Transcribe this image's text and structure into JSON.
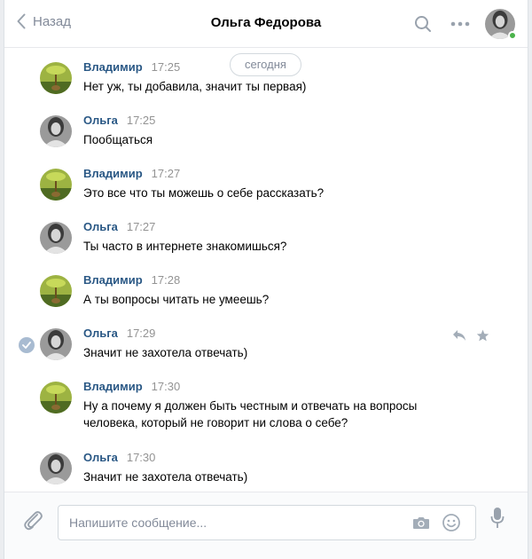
{
  "header": {
    "back_label": "Назад",
    "title": "Ольга Федорова",
    "online_color": "#4bb34b",
    "icons": [
      "chevron-left-icon",
      "search-icon",
      "more-icon"
    ]
  },
  "history": {
    "date_label": "сегодня",
    "messages": [
      {
        "author": "Владимир",
        "time": "17:25",
        "text": "Нет уж, ты добавила, значит ты первая)"
      },
      {
        "author": "Ольга",
        "time": "17:25",
        "text": "Пообщаться"
      },
      {
        "author": "Владимир",
        "time": "17:27",
        "text": "Это все что ты можешь о себе рассказать?"
      },
      {
        "author": "Ольга",
        "time": "17:27",
        "text": "Ты часто в интернете знакомишься?"
      },
      {
        "author": "Владимир",
        "time": "17:28",
        "text": "А ты вопросы читать не умеешь?"
      },
      {
        "author": "Ольга",
        "time": "17:29",
        "text": "Значит не захотела отвечать)",
        "selected": true
      },
      {
        "author": "Владимир",
        "time": "17:30",
        "text": "Ну а почему я должен быть честным и отвечать на вопросы человека, который не говорит ни слова о себе?"
      },
      {
        "author": "Ольга",
        "time": "17:30",
        "text": "Значит не захотела отвечать)"
      }
    ]
  },
  "composer": {
    "placeholder": "Напишите сообщение...",
    "icons": [
      "paperclip-icon",
      "camera-icon",
      "smile-icon",
      "microphone-icon"
    ]
  },
  "colors": {
    "link": "#2a5885",
    "muted": "#828a99",
    "accent_check": "#a8bbd1"
  }
}
